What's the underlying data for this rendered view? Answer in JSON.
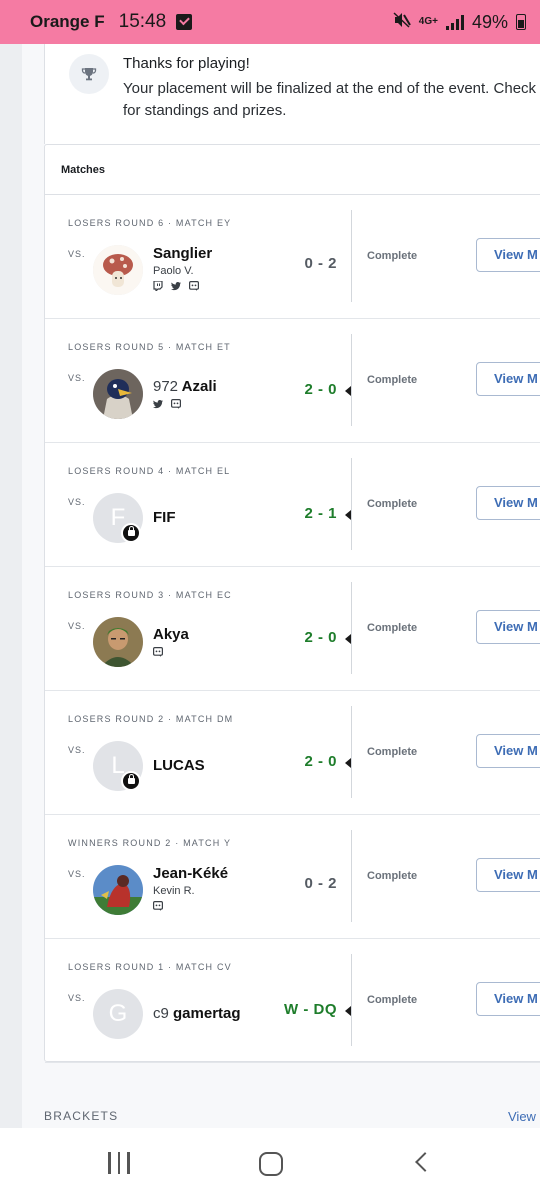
{
  "status_bar": {
    "carrier": "Orange F",
    "time": "15:48",
    "network": "4G+",
    "battery": "49%"
  },
  "thanks": {
    "title": "Thanks for playing!",
    "text": "Your placement will be finalized at the end of the event. Check for standings and prizes."
  },
  "matches": {
    "header": "Matches",
    "vs_label": "VS.",
    "items": [
      {
        "round": "LOSERS ROUND 6 · MATCH EY",
        "prefix": "",
        "name": "Sanglier",
        "sub": "Paolo V.",
        "socials": [
          "twitch",
          "twitter",
          "discord"
        ],
        "score": "0 - 2",
        "result": "lose",
        "status": "Complete",
        "button": "View M",
        "avatar_type": "image",
        "avatar_letter": ""
      },
      {
        "round": "LOSERS ROUND 5 · MATCH ET",
        "prefix": "972",
        "name": "Azali",
        "sub": "",
        "socials": [
          "twitter",
          "discord"
        ],
        "score": "2 - 0",
        "result": "win",
        "status": "Complete",
        "button": "View M",
        "avatar_type": "image",
        "avatar_letter": ""
      },
      {
        "round": "LOSERS ROUND 4 · MATCH EL",
        "prefix": "",
        "name": "FIF",
        "sub": "",
        "socials": [],
        "score": "2 - 1",
        "result": "win",
        "status": "Complete",
        "button": "View M",
        "avatar_type": "letter",
        "avatar_letter": "F",
        "locked": true
      },
      {
        "round": "LOSERS ROUND 3 · MATCH EC",
        "prefix": "",
        "name": "Akya",
        "sub": "",
        "socials": [
          "discord"
        ],
        "score": "2 - 0",
        "result": "win",
        "status": "Complete",
        "button": "View M",
        "avatar_type": "image",
        "avatar_letter": ""
      },
      {
        "round": "LOSERS ROUND 2 · MATCH DM",
        "prefix": "",
        "name": "LUCAS",
        "sub": "",
        "socials": [],
        "score": "2 - 0",
        "result": "win",
        "status": "Complete",
        "button": "View M",
        "avatar_type": "letter",
        "avatar_letter": "L",
        "locked": true
      },
      {
        "round": "WINNERS ROUND 2 · MATCH Y",
        "prefix": "",
        "name": "Jean-Kéké",
        "sub": "Kevin R.",
        "socials": [
          "discord"
        ],
        "score": "0 - 2",
        "result": "lose",
        "status": "Complete",
        "button": "View M",
        "avatar_type": "image",
        "avatar_letter": ""
      },
      {
        "round": "LOSERS ROUND 1 · MATCH CV",
        "prefix": "c9",
        "name": "gamertag",
        "sub": "",
        "socials": [],
        "score": "W - DQ",
        "result": "win",
        "status": "Complete",
        "button": "View M",
        "avatar_type": "letter",
        "avatar_letter": "G"
      }
    ]
  },
  "brackets": {
    "label": "BRACKETS",
    "view": "View"
  },
  "colors": {
    "status_bar": "#f57ba3",
    "win": "#1e7d2b",
    "lose": "#555b63",
    "link": "#3e6db5"
  }
}
